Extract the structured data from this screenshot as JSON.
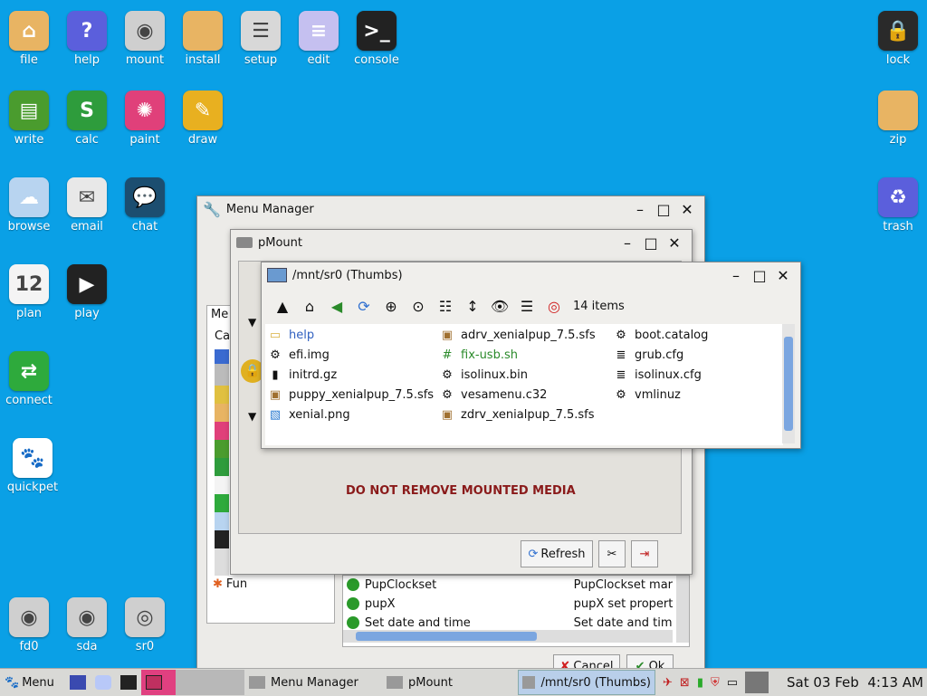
{
  "desktop": {
    "icons_left": [
      {
        "label": "file",
        "icon": "folder-icon",
        "color": "#e8b463",
        "glyph": "⌂"
      },
      {
        "label": "help",
        "icon": "help-icon",
        "color": "#5b5fdc",
        "glyph": "?"
      },
      {
        "label": "mount",
        "icon": "disk-icon",
        "color": "#cfcfcf",
        "glyph": "◉"
      },
      {
        "label": "install",
        "icon": "box-icon",
        "color": "#e8b463",
        "glyph": ""
      },
      {
        "label": "setup",
        "icon": "sliders-icon",
        "color": "#d8d8d8",
        "glyph": "☰"
      },
      {
        "label": "edit",
        "icon": "notepad-icon",
        "color": "#c5c0f0",
        "glyph": "≡"
      },
      {
        "label": "console",
        "icon": "terminal-icon",
        "color": "#222222",
        "glyph": ">_"
      },
      {
        "label": "write",
        "icon": "document-icon",
        "color": "#4a9c2e",
        "glyph": "▤"
      },
      {
        "label": "calc",
        "icon": "spreadsheet-icon",
        "color": "#2e9c3c",
        "glyph": "S"
      },
      {
        "label": "paint",
        "icon": "palette-icon",
        "color": "#e0407a",
        "glyph": "✺"
      },
      {
        "label": "draw",
        "icon": "draw-icon",
        "color": "#e8b020",
        "glyph": "✎"
      },
      {
        "label": "browse",
        "icon": "cloud-icon",
        "color": "#b8d4f0",
        "glyph": "☁"
      },
      {
        "label": "email",
        "icon": "envelope-icon",
        "color": "#e8e8e8",
        "glyph": "✉"
      },
      {
        "label": "chat",
        "icon": "chat-bubble-icon",
        "color": "#1c4e70",
        "glyph": "💬"
      },
      {
        "label": "plan",
        "icon": "calendar-icon",
        "color": "#f4f4f4",
        "glyph": "12"
      },
      {
        "label": "play",
        "icon": "clapperboard-icon",
        "color": "#222222",
        "glyph": "▶"
      },
      {
        "label": "connect",
        "icon": "arrows-icon",
        "color": "#2eaa3c",
        "glyph": "⇄"
      },
      {
        "label": "quickpet",
        "icon": "dog-icon",
        "color": "#ffffff",
        "glyph": "🐾"
      },
      {
        "label": "fd0",
        "icon": "drive-icon",
        "color": "#cfcfcf",
        "glyph": "◉"
      },
      {
        "label": "sda",
        "icon": "drive-icon",
        "color": "#cfcfcf",
        "glyph": "◉"
      },
      {
        "label": "sr0",
        "icon": "cdrom-icon",
        "color": "#cfcfcf",
        "glyph": "◎"
      }
    ],
    "icons_right": [
      {
        "label": "lock",
        "icon": "lock-icon",
        "color": "#2a2a2a",
        "glyph": "🔒"
      },
      {
        "label": "zip",
        "icon": "archive-icon",
        "color": "#e8b463",
        "glyph": ""
      },
      {
        "label": "trash",
        "icon": "recycle-icon",
        "color": "#5b5fdc",
        "glyph": "♻"
      }
    ]
  },
  "menu_manager": {
    "title": "Menu Manager",
    "left_list_header": "Me",
    "col_header": "Ca",
    "category_fun": "Fun",
    "rows": [
      {
        "name": "PupClockset",
        "desc": "PupClockset mar"
      },
      {
        "name": "pupX",
        "desc": "pupX set properti"
      },
      {
        "name": "Set date and time",
        "desc": "Set date and tim"
      }
    ],
    "cancel_label": "Cancel",
    "ok_label": "Ok"
  },
  "pmount": {
    "title": "pMount",
    "warning": "DO NOT REMOVE MOUNTED MEDIA",
    "refresh_label": "Refresh"
  },
  "rox": {
    "title": "/mnt/sr0 (Thumbs)",
    "item_count": "14 items",
    "files": [
      {
        "name": "help",
        "icon": "folder-icon",
        "color": "#3060c0"
      },
      {
        "name": "efi.img",
        "icon": "gear-icon",
        "color": "#111111"
      },
      {
        "name": "initrd.gz",
        "icon": "archive-icon",
        "color": "#111111"
      },
      {
        "name": "puppy_xenialpup_7.5.sfs",
        "icon": "package-icon",
        "color": "#111111"
      },
      {
        "name": "xenial.png",
        "icon": "image-icon",
        "color": "#111111"
      },
      {
        "name": "adrv_xenialpup_7.5.sfs",
        "icon": "package-icon",
        "color": "#111111"
      },
      {
        "name": "fix-usb.sh",
        "icon": "script-icon",
        "color": "#2a8a2a"
      },
      {
        "name": "isolinux.bin",
        "icon": "gear-icon",
        "color": "#111111"
      },
      {
        "name": "vesamenu.c32",
        "icon": "gear-icon",
        "color": "#111111"
      },
      {
        "name": "zdrv_xenialpup_7.5.sfs",
        "icon": "package-icon",
        "color": "#111111"
      },
      {
        "name": "boot.catalog",
        "icon": "gear-icon",
        "color": "#111111"
      },
      {
        "name": "grub.cfg",
        "icon": "text-file-icon",
        "color": "#111111"
      },
      {
        "name": "isolinux.cfg",
        "icon": "text-file-icon",
        "color": "#111111"
      },
      {
        "name": "vmlinuz",
        "icon": "gear-icon",
        "color": "#111111"
      }
    ]
  },
  "taskbar": {
    "menu_label": "Menu",
    "tasks": [
      {
        "label": "Menu Manager"
      },
      {
        "label": "pMount"
      },
      {
        "label": "/mnt/sr0 (Thumbs)"
      }
    ],
    "clock": "Sat 03 Feb  4:13 AM"
  }
}
